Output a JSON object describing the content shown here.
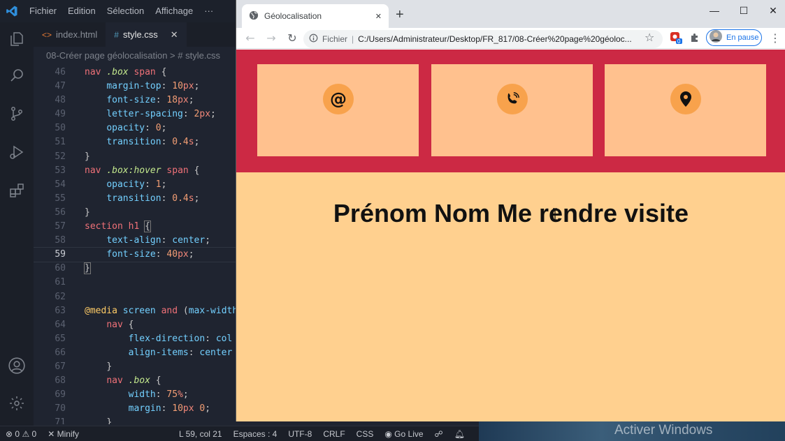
{
  "vscode": {
    "menu": [
      "Fichier",
      "Edition",
      "Sélection",
      "Affichage",
      "···"
    ],
    "tabs": [
      {
        "icon": "<>",
        "label": "index.html",
        "active": false
      },
      {
        "icon": "#",
        "label": "style.css",
        "active": true,
        "close": "✕"
      }
    ],
    "breadcrumb": "08-Créer page géolocalisation  >  #  style.css",
    "lines": [
      {
        "n": "46",
        "html": "<span class='tg'>nav</span> <span class='cls'>.box</span> <span class='tg'>span</span> <span class='pn'>{</span>"
      },
      {
        "n": "47",
        "html": "    <span class='pr'>margin-top</span>: <span class='nm'>10</span><span class='un'>px</span>;"
      },
      {
        "n": "48",
        "html": "    <span class='pr'>font-size</span>: <span class='nm'>18</span><span class='un'>px</span>;"
      },
      {
        "n": "49",
        "html": "    <span class='pr'>letter-spacing</span>: <span class='nm'>2</span><span class='un'>px</span>;"
      },
      {
        "n": "50",
        "html": "    <span class='pr'>opacity</span>: <span class='nm'>0</span>;"
      },
      {
        "n": "51",
        "html": "    <span class='pr'>transition</span>: <span class='nm'>0.4</span><span class='un'>s</span>;"
      },
      {
        "n": "52",
        "html": "<span class='pn'>}</span>"
      },
      {
        "n": "53",
        "html": "<span class='tg'>nav</span> <span class='cls'>.box:hover</span> <span class='tg'>span</span> <span class='pn'>{</span>"
      },
      {
        "n": "54",
        "html": "    <span class='pr'>opacity</span>: <span class='nm'>1</span>;"
      },
      {
        "n": "55",
        "html": "    <span class='pr'>transition</span>: <span class='nm'>0.4</span><span class='un'>s</span>;"
      },
      {
        "n": "56",
        "html": "<span class='pn'>}</span>"
      },
      {
        "n": "57",
        "html": "<span class='tg'>section</span> <span class='tg'>h1</span> <span class='pn' style='outline:1px solid #777'>{</span>"
      },
      {
        "n": "58",
        "html": "    <span class='pr'>text-align</span>: <span class='vl'>center</span>;"
      },
      {
        "n": "59",
        "html": "    <span class='pr'>font-size</span>: <span class='nm'>40</span><span class='un'>px</span>;",
        "current": true
      },
      {
        "n": "60",
        "html": "<span class='pn' style='outline:1px solid #777'>}</span>"
      },
      {
        "n": "61",
        "html": ""
      },
      {
        "n": "62",
        "html": ""
      },
      {
        "n": "63",
        "html": "<span class='at'>@media</span> <span class='pr'>screen</span> <span class='kw'>and</span> (<span class='pr'>max-width</span>"
      },
      {
        "n": "64",
        "html": "    <span class='tg'>nav</span> <span class='pn'>{</span>"
      },
      {
        "n": "65",
        "html": "        <span class='pr'>flex-direction</span>: <span class='vl'>col</span>"
      },
      {
        "n": "66",
        "html": "        <span class='pr'>align-items</span>: <span class='vl'>center</span>"
      },
      {
        "n": "67",
        "html": "    <span class='pn'>}</span>"
      },
      {
        "n": "68",
        "html": "    <span class='tg'>nav</span> <span class='cls'>.box</span> <span class='pn'>{</span>"
      },
      {
        "n": "69",
        "html": "        <span class='pr'>width</span>: <span class='nm'>75</span><span class='un'>%</span>;"
      },
      {
        "n": "70",
        "html": "        <span class='pr'>margin</span>: <span class='nm'>10</span><span class='un'>px</span> <span class='nm'>0</span>;"
      },
      {
        "n": "71",
        "html": "    <span class='pn'>}</span>"
      }
    ],
    "status": {
      "errors": "0",
      "warnings": "0",
      "minify": "Minify",
      "position": "L 59, col 21",
      "spaces": "Espaces : 4",
      "encoding": "UTF-8",
      "eol": "CRLF",
      "language": "CSS",
      "golive": "Go Live"
    }
  },
  "windows_watermark": "Activer Windows",
  "chrome": {
    "tab_title": "Géolocalisation",
    "tab_close": "✕",
    "new_tab": "+",
    "url_scheme": "Fichier",
    "url_sep": "|",
    "url": "C:/Users/Administrateur/Desktop/FR_817/08-Créer%20page%20géoloc...",
    "extension_badge": "0",
    "profile_label": "En pause",
    "window_controls": {
      "minimize": "—",
      "maximize": "☐",
      "close": "✕"
    }
  },
  "page": {
    "colors": {
      "nav_bg": "#cc2944",
      "box_bg": "#ffc18e",
      "icon_circle": "#f8a24c",
      "section_bg": "#ffd08f"
    },
    "boxes": [
      {
        "icon": "at-icon",
        "glyph": "@"
      },
      {
        "icon": "phone-icon",
        "glyph": ""
      },
      {
        "icon": "location-pin-icon",
        "glyph": ""
      }
    ],
    "h1": "Prénom Nom Me rendre visite"
  }
}
